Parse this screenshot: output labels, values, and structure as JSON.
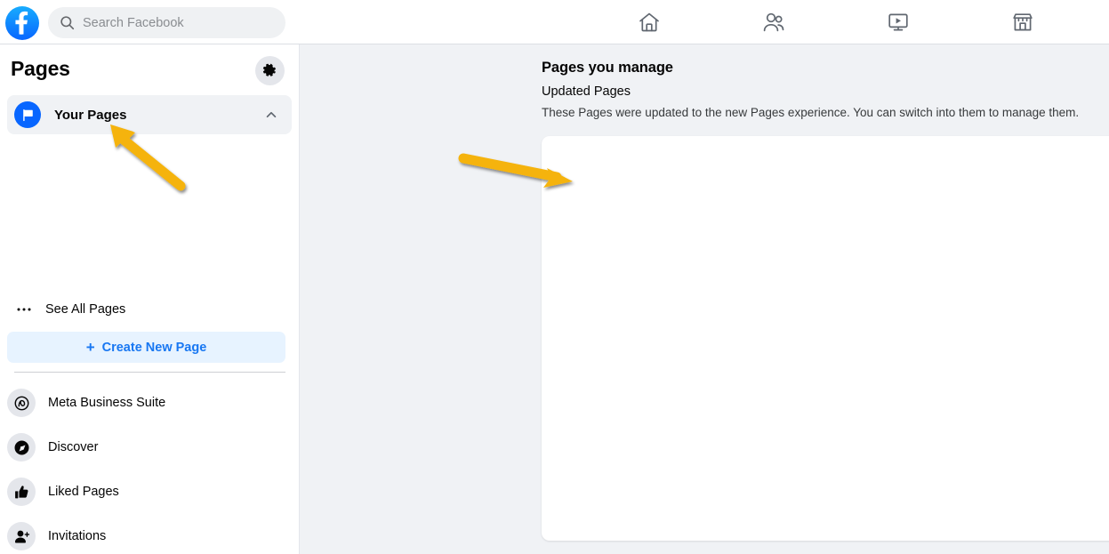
{
  "topbar": {
    "logo": "facebook-logo",
    "search": {
      "placeholder": "Search Facebook",
      "value": "",
      "icon": "search-icon"
    },
    "nav": [
      {
        "name": "home",
        "icon": "home-icon",
        "label": "Home"
      },
      {
        "name": "friends",
        "icon": "friends-icon",
        "label": "Friends"
      },
      {
        "name": "watch",
        "icon": "video-icon",
        "label": "Watch"
      },
      {
        "name": "marketplace",
        "icon": "marketplace-icon",
        "label": "Marketplace"
      }
    ]
  },
  "sidebar": {
    "title": "Pages",
    "settings_icon": "gear-icon",
    "your_pages": {
      "label": "Your Pages",
      "icon": "flag-icon",
      "expanded": true,
      "chevron": "chevron-up-icon",
      "pages": []
    },
    "see_all": {
      "label": "See All Pages",
      "icon": "dots-icon"
    },
    "create_page": {
      "label": "Create New Page",
      "plus": "+"
    },
    "menu": [
      {
        "label": "Meta Business Suite",
        "icon": "meta-business-suite-icon"
      },
      {
        "label": "Discover",
        "icon": "discover-icon"
      },
      {
        "label": "Liked Pages",
        "icon": "thumbs-up-icon"
      },
      {
        "label": "Invitations",
        "icon": "person-add-icon"
      }
    ]
  },
  "main": {
    "heading": "Pages you manage",
    "subheading": "Updated Pages",
    "description": "These Pages were updated to the new Pages experience. You can switch into them to manage them.",
    "card_items": []
  },
  "annotations": {
    "arrow_color": "#f5b30a",
    "arrows": [
      {
        "name": "arrow-to-your-pages",
        "points_to": "Your Pages"
      },
      {
        "name": "arrow-to-pages-card",
        "points_to": "Pages card"
      }
    ]
  },
  "colors": {
    "brand_blue": "#0866ff",
    "link_blue": "#1877f2",
    "page_background": "#f0f2f5",
    "surface": "#ffffff",
    "accent_yellow": "#f5b30a"
  }
}
